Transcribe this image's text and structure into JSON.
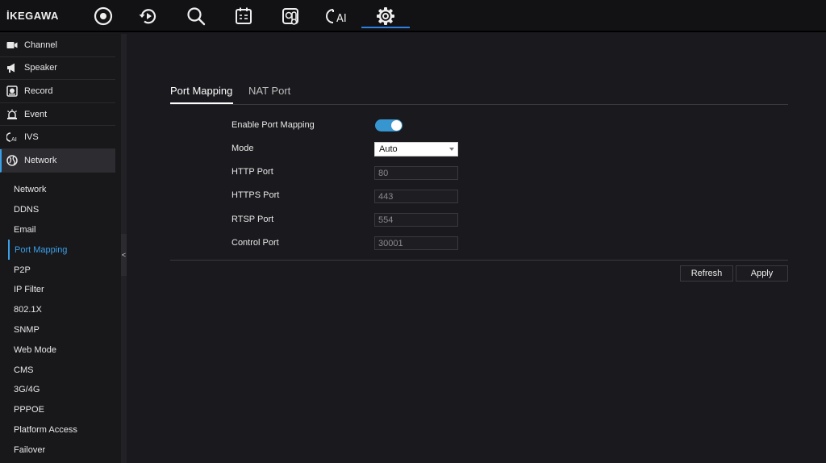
{
  "brand": {
    "logo_text": "İKEGAWA"
  },
  "topnav": {
    "items": [
      {
        "name": "live-view",
        "icon": "live-view-icon"
      },
      {
        "name": "playback",
        "icon": "playback-icon"
      },
      {
        "name": "search",
        "icon": "search-icon"
      },
      {
        "name": "schedule",
        "icon": "calendar-icon"
      },
      {
        "name": "temperature",
        "icon": "thermometer-icon"
      },
      {
        "name": "ai",
        "icon": "ai-icon",
        "label": "AI"
      },
      {
        "name": "settings",
        "icon": "gear-icon",
        "active": true
      }
    ],
    "accent": "#2f7fe0"
  },
  "sidebar": {
    "items": [
      {
        "label": "Channel",
        "icon": "camera-icon"
      },
      {
        "label": "Speaker",
        "icon": "speaker-icon"
      },
      {
        "label": "Record",
        "icon": "record-icon"
      },
      {
        "label": "Event",
        "icon": "alarm-icon"
      },
      {
        "label": "IVS",
        "icon": "ivs-icon"
      },
      {
        "label": "Network",
        "icon": "globe-icon",
        "active": true
      }
    ],
    "subitems": [
      {
        "label": "Network"
      },
      {
        "label": "DDNS"
      },
      {
        "label": "Email"
      },
      {
        "label": "Port Mapping",
        "active": true
      },
      {
        "label": "P2P"
      },
      {
        "label": "IP Filter"
      },
      {
        "label": "802.1X"
      },
      {
        "label": "SNMP"
      },
      {
        "label": "Web Mode"
      },
      {
        "label": "CMS"
      },
      {
        "label": "3G/4G"
      },
      {
        "label": "PPPOE"
      },
      {
        "label": "Platform Access"
      },
      {
        "label": "Failover"
      }
    ],
    "collapse_glyph": "<",
    "accent": "#3aa0e8"
  },
  "tabs": [
    {
      "label": "Port Mapping",
      "active": true
    },
    {
      "label": "NAT Port"
    }
  ],
  "form": {
    "enable_label": "Enable Port Mapping",
    "enable_on": true,
    "mode_label": "Mode",
    "mode_value": "Auto",
    "http_label": "HTTP Port",
    "http_value": "80",
    "https_label": "HTTPS Port",
    "https_value": "443",
    "rtsp_label": "RTSP Port",
    "rtsp_value": "554",
    "control_label": "Control Port",
    "control_value": "30001",
    "toggle_color": "#3796cf"
  },
  "buttons": {
    "refresh": "Refresh",
    "apply": "Apply"
  }
}
